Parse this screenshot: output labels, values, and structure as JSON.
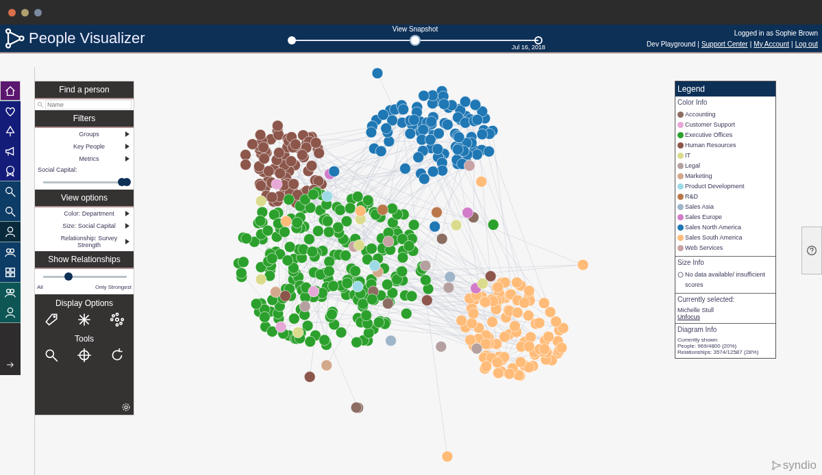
{
  "app": {
    "title": "People Visualizer"
  },
  "timeline": {
    "label": "View Snapshot",
    "date": "Jul 16, 2018",
    "points": [
      {
        "selected": false
      },
      {
        "selected": true
      },
      {
        "selected": false
      }
    ]
  },
  "user": {
    "logged_in": "Logged in as Sophie Brown",
    "links": [
      "Dev Playground",
      "Support Center",
      "My Account",
      "Log out"
    ],
    "separator": "|"
  },
  "rail": [
    [
      {
        "selected": true
      }
    ],
    [
      {
        "selected": false
      },
      {
        "selected": false
      },
      {
        "selected": false
      },
      {
        "selected": false
      }
    ],
    [
      {
        "selected": false
      },
      {
        "selected": false
      }
    ],
    [
      {
        "selected": false
      }
    ],
    [
      {
        "selected": false
      },
      {
        "selected": false
      }
    ],
    [
      {
        "selected": false
      },
      {
        "selected": false
      }
    ]
  ],
  "find": {
    "title": "Find a person",
    "placeholder": "Name"
  },
  "filters": {
    "title": "Filters",
    "items": [
      "Groups",
      "Key People",
      "Metrics"
    ],
    "slider_label": "Social Capital: ",
    "low": {
      "level": 0.94
    },
    "high": {
      "level": 1.0
    }
  },
  "view_options": {
    "title": "View options",
    "items": [
      "Color: Department",
      "Size: Social Capital",
      "Relationship: Survey Strength"
    ]
  },
  "relationships": {
    "title": "Show Relationships",
    "level": 0.3,
    "min_label": "All",
    "max_label": "Only Strongest"
  },
  "display_options": {
    "title": "Display Options"
  },
  "tools": {
    "title": "Tools"
  },
  "legend": {
    "title": "Legend",
    "color_title": "Color Info",
    "items": [
      {
        "label": "Accounting",
        "color": "#8c6d62"
      },
      {
        "label": "Customer Support",
        "color": "#e6a8d7"
      },
      {
        "label": "Executive Offices",
        "color": "#2ca02c"
      },
      {
        "label": "Human Resources",
        "color": "#8c564b"
      },
      {
        "label": "IT",
        "color": "#dbdb8d"
      },
      {
        "label": "Legal",
        "color": "#b5a0a0"
      },
      {
        "label": "Marketing",
        "color": "#d4a88a"
      },
      {
        "label": "Product Development",
        "color": "#9edae5"
      },
      {
        "label": "R&D",
        "color": "#b9774a"
      },
      {
        "label": "Sales Asia",
        "color": "#9fb5c9"
      },
      {
        "label": "Sales Europe",
        "color": "#d17bc9"
      },
      {
        "label": "Sales North America",
        "color": "#1f77b4"
      },
      {
        "label": "Sales South America",
        "color": "#ffbb78"
      },
      {
        "label": "Web Services",
        "color": "#c7a3a3"
      }
    ],
    "size_title": "Size Info",
    "size_text": "No data available/ insufficient scores",
    "selected_title": "Currently selected:",
    "selected_name": "Michelle Stull",
    "selected_link": "Unfocus",
    "diagram_title": "Diagram Info",
    "diagram_lines": [
      "Currently shown:",
      "People: 969/4800 (20%)",
      "Relationships: 3574/12587 (28%)"
    ]
  },
  "brand": {
    "name": "syndio"
  }
}
